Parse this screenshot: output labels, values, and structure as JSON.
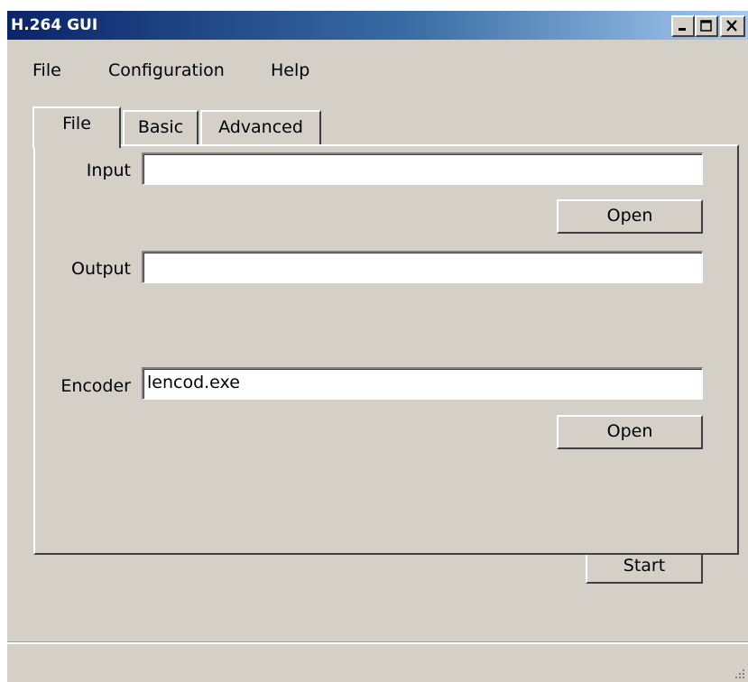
{
  "window": {
    "title": "H.264 GUI",
    "minimize_icon": "minimize-icon",
    "maximize_icon": "maximize-icon",
    "close_icon": "close-icon"
  },
  "menu": {
    "items": [
      "File",
      "Configuration",
      "Help"
    ]
  },
  "tabs": [
    {
      "label": "File",
      "active": true
    },
    {
      "label": "Basic",
      "active": false
    },
    {
      "label": "Advanced",
      "active": false
    }
  ],
  "file_tab": {
    "input": {
      "label": "Input",
      "value": ""
    },
    "input_open_button": "Open",
    "output": {
      "label": "Output",
      "value": ""
    },
    "encoder": {
      "label": "Encoder",
      "value": "lencod.exe"
    },
    "encoder_open_button": "Open"
  },
  "footer": {
    "start_button": "Start",
    "grip_icon": "resize-grip-icon"
  },
  "colors": {
    "window_background": "#d4d0c8",
    "titlebar_start": "#0a246a",
    "titlebar_end": "#a6caf0",
    "title_text": "#ffffff"
  }
}
